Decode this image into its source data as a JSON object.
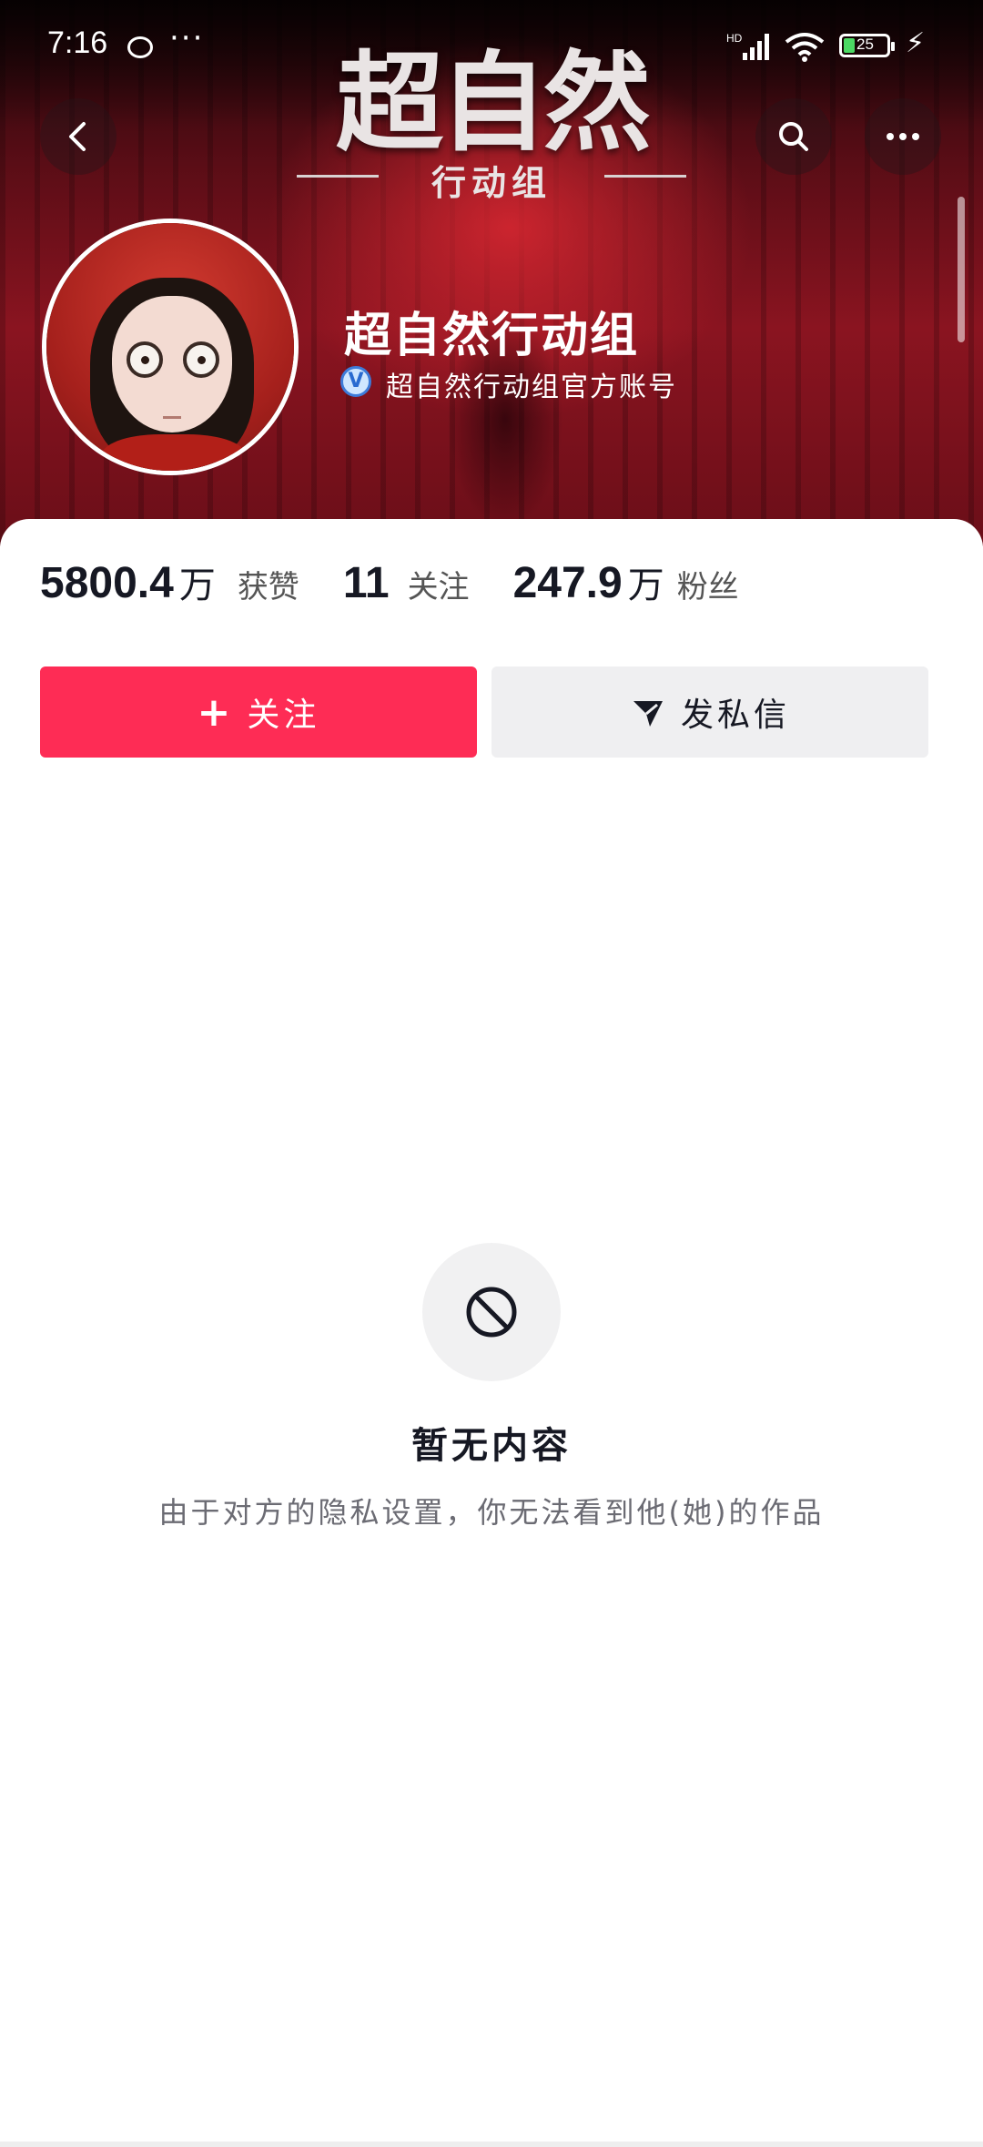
{
  "status_bar": {
    "time": "7:16",
    "more": "···",
    "network": "HD",
    "battery": "25"
  },
  "header": {
    "logo_main": "超自然",
    "logo_sub": "行动组"
  },
  "profile": {
    "name": "超自然行动组",
    "verified_mark": "V",
    "verified_text": "超自然行动组官方账号"
  },
  "stats": [
    {
      "value": "5800.4",
      "unit": "万",
      "label": "获赞"
    },
    {
      "value": "11",
      "unit": "",
      "label": "关注"
    },
    {
      "value": "247.9",
      "unit": "万",
      "label": "粉丝"
    }
  ],
  "actions": {
    "follow_label": "关注",
    "message_label": "发私信"
  },
  "empty_state": {
    "title": "暂无内容",
    "description": "由于对方的隐私设置，你无法看到他(她)的作品"
  },
  "colors": {
    "follow_button": "#fe2c55",
    "message_button": "#efeff1",
    "banner": "#8a1420"
  },
  "icons": [
    "back-icon",
    "search-icon",
    "more-icon",
    "plus-icon",
    "send-icon",
    "blocked-icon",
    "verified-icon",
    "signal-icon",
    "wifi-icon",
    "battery-icon"
  ]
}
